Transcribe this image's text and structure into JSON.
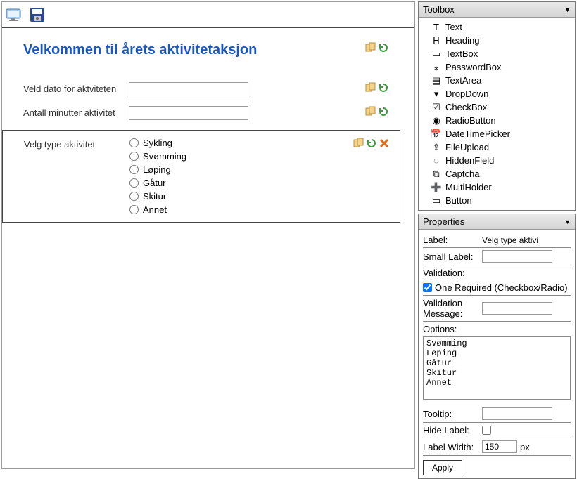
{
  "heading": "Velkommen til årets aktivitetaksjon",
  "field_date_label": "Veld dato for aktviteten",
  "field_minutes_label": "Antall minutter aktivitet",
  "field_type_label": "Velg type aktivitet",
  "radio_options": [
    "Sykling",
    "Svømming",
    "Løping",
    "Gåtur",
    "Skitur",
    "Annet"
  ],
  "toolbox": {
    "title": "Toolbox",
    "items": [
      "Text",
      "Heading",
      "TextBox",
      "PasswordBox",
      "TextArea",
      "DropDown",
      "CheckBox",
      "RadioButton",
      "DateTimePicker",
      "FileUpload",
      "HiddenField",
      "Captcha",
      "MultiHolder",
      "Button"
    ]
  },
  "properties": {
    "title": "Properties",
    "label_key": "Label:",
    "label_value": "Velg type aktivi",
    "small_label_key": "Small Label:",
    "small_label_value": "",
    "validation_key": "Validation:",
    "validation_opt": "One Required (Checkbox/Radio)",
    "validation_checked": true,
    "validation_msg_key": "Validation Message:",
    "validation_msg_value": "",
    "options_key": "Options:",
    "options_list": [
      "Svømming",
      "Løping",
      "Gåtur",
      "Skitur",
      "Annet"
    ],
    "tooltip_key": "Tooltip:",
    "tooltip_value": "",
    "hide_label_key": "Hide Label:",
    "hide_label_checked": false,
    "label_width_key": "Label Width:",
    "label_width_value": "150",
    "label_width_unit": "px",
    "apply": "Apply"
  }
}
